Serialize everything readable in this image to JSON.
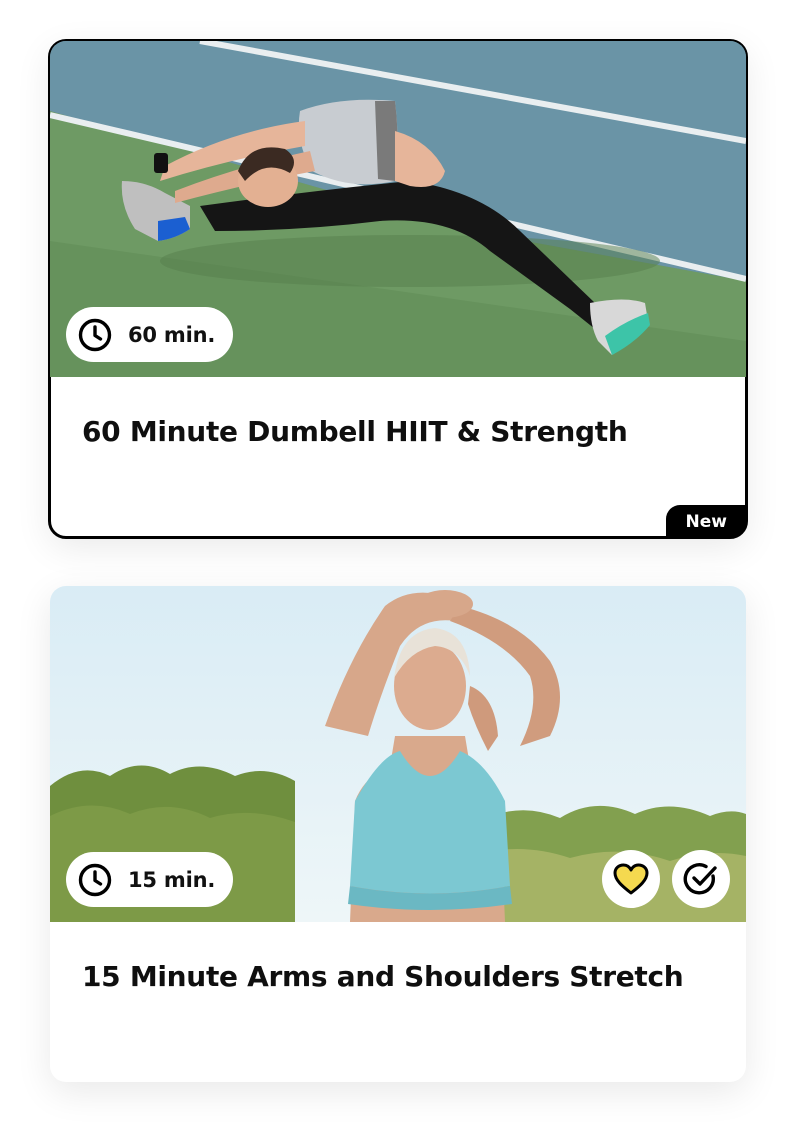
{
  "workouts": [
    {
      "title": "60 Minute Dumbell HIIT & Strength",
      "duration": "60 min.",
      "badge": "New",
      "duration_icon": "clock-icon",
      "image": "woman-stretching-on-court"
    },
    {
      "title": "15 Minute Arms and Shoulders Stretch",
      "duration": "15 min.",
      "duration_icon": "clock-icon",
      "favorite_icon": "heart-icon",
      "complete_icon": "check-circle-icon",
      "image": "woman-stretching-arms-outdoors"
    }
  ],
  "colors": {
    "favorite_fill": "#f5d94f",
    "card_border_featured": "#000000",
    "badge_background": "#000000"
  }
}
